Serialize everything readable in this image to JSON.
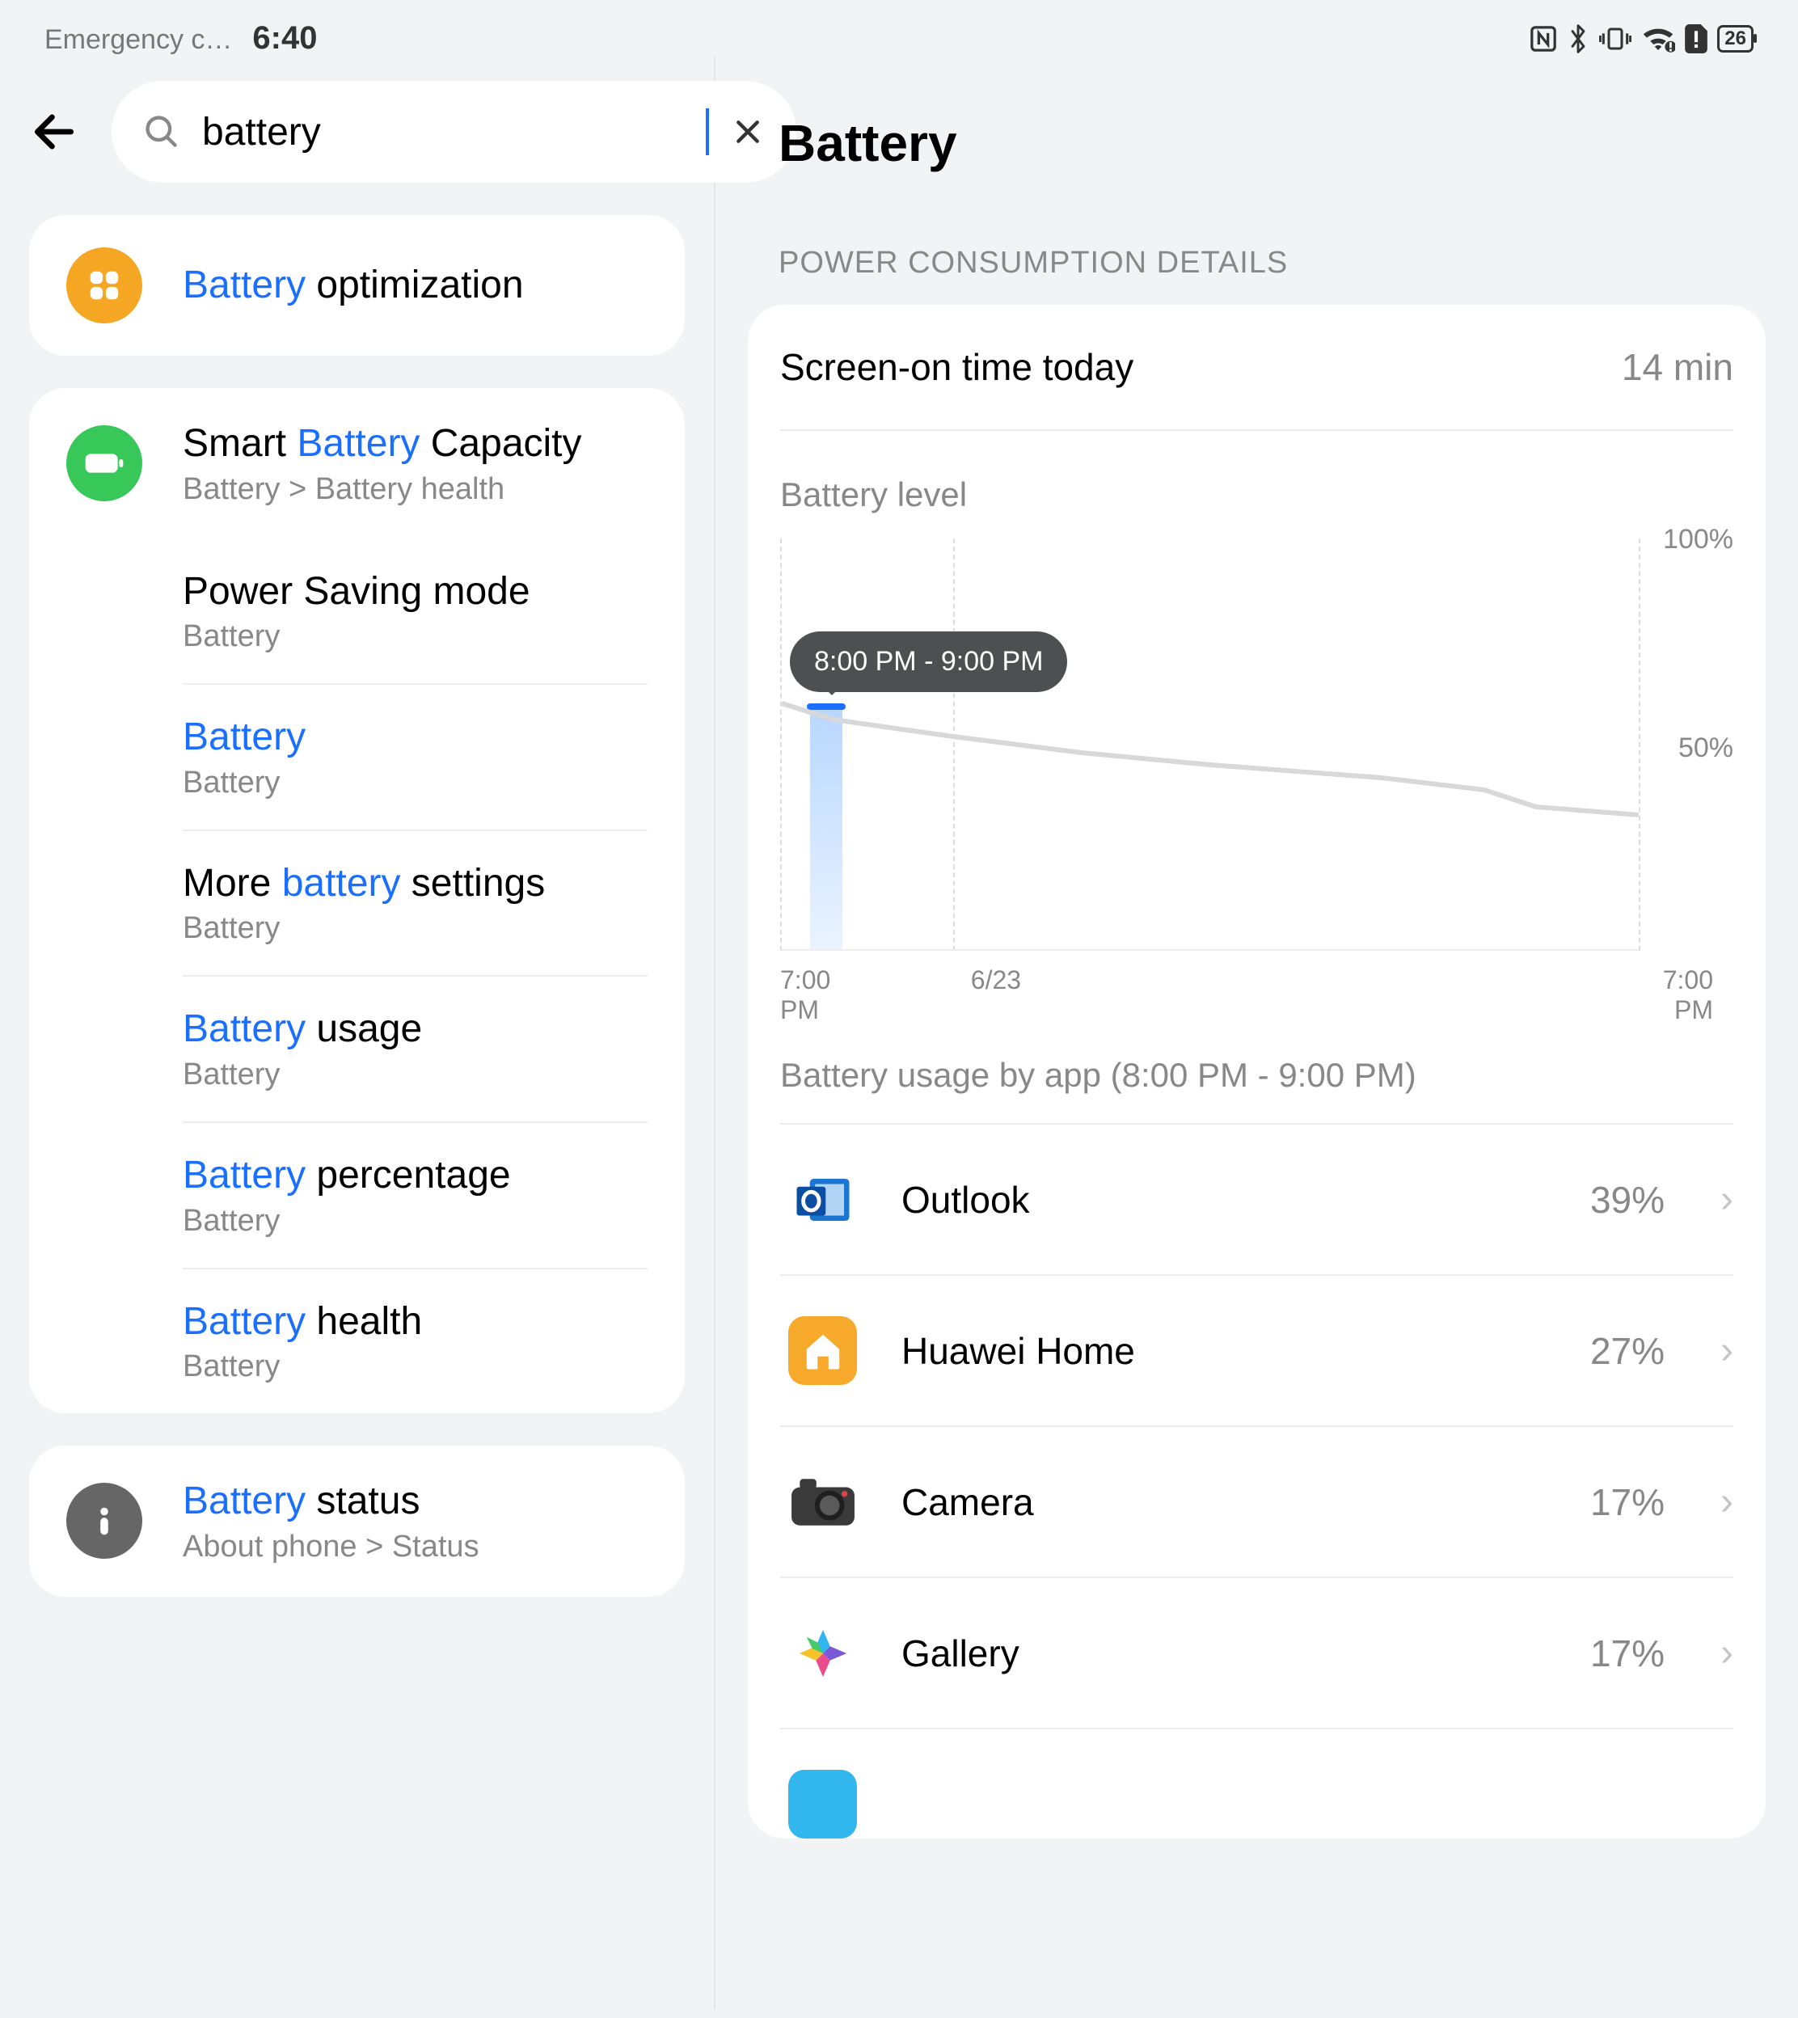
{
  "status": {
    "emergency": "Emergency c…",
    "time": "6:40",
    "battery_pct": "26"
  },
  "search": {
    "value": "battery"
  },
  "results": {
    "top": {
      "title_hl": "Battery",
      "title_rest": " optimization"
    },
    "group2_header": {
      "pre": "Smart ",
      "hl": "Battery",
      "post": " Capacity",
      "sub": "Battery > Battery health"
    },
    "group2": [
      {
        "pre": "",
        "hl": "",
        "title": "Power Saving mode",
        "sub": "Battery"
      },
      {
        "pre": "",
        "hl": "Battery",
        "post": "",
        "sub": "Battery"
      },
      {
        "pre": "More ",
        "hl": "battery",
        "post": " settings",
        "sub": "Battery"
      },
      {
        "pre": "",
        "hl": "Battery",
        "post": " usage",
        "sub": "Battery"
      },
      {
        "pre": "",
        "hl": "Battery",
        "post": " percentage",
        "sub": "Battery"
      },
      {
        "pre": "",
        "hl": "Battery",
        "post": " health",
        "sub": "Battery"
      }
    ],
    "group3": {
      "hl": "Battery",
      "post": " status",
      "sub": "About phone > Status"
    }
  },
  "right": {
    "title": "Battery",
    "section": "POWER CONSUMPTION DETAILS",
    "screen_on_label": "Screen-on time today",
    "screen_on_value": "14 min",
    "chart_title": "Battery level",
    "tooltip": "8:00 PM - 9:00 PM",
    "usage_title": "Battery usage by app (8:00 PM - 9:00 PM)",
    "x_start": "7:00",
    "x_start_sub": "PM",
    "x_mid": "6/23",
    "x_end": "7:00",
    "x_end_sub": "PM",
    "y_top": "100%",
    "y_mid": "50%",
    "apps": [
      {
        "name": "Outlook",
        "pct": "39%"
      },
      {
        "name": "Huawei Home",
        "pct": "27%"
      },
      {
        "name": "Camera",
        "pct": "17%"
      },
      {
        "name": "Gallery",
        "pct": "17%"
      }
    ]
  },
  "chart_data": {
    "type": "line",
    "title": "Battery level",
    "xlabel": "",
    "ylabel": "",
    "ylim": [
      0,
      100
    ],
    "x_range": [
      "7:00 PM (6/22)",
      "7:00 PM (6/23)"
    ],
    "x": [
      0.0,
      0.03,
      0.06,
      0.2,
      0.35,
      0.5,
      0.7,
      0.82,
      0.88,
      1.0
    ],
    "values": [
      60,
      58,
      56,
      52,
      48,
      45,
      42,
      39,
      35,
      33
    ],
    "selected_range": "8:00 PM - 9:00 PM",
    "x_ticks": [
      "7:00 PM",
      "6/23",
      "7:00 PM"
    ]
  }
}
